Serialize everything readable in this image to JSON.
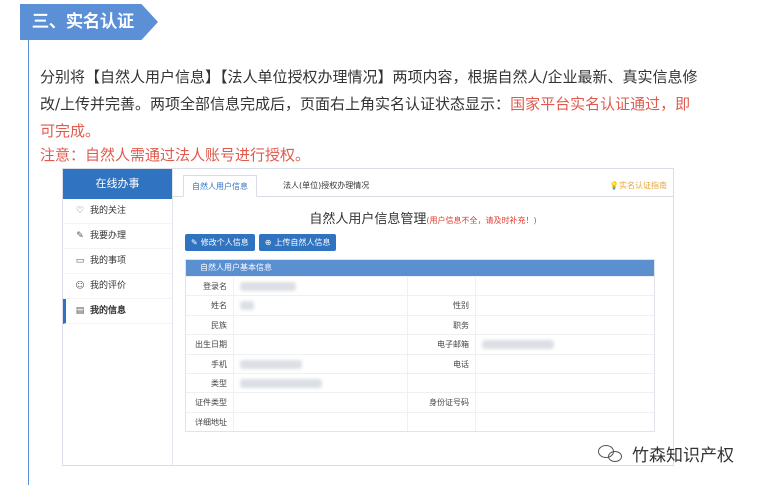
{
  "section": {
    "title": "三、实名认证"
  },
  "intro": {
    "text_plain": "分别将【自然人用户信息】【法人单位授权办理情况】两项内容，根据自然人/企业最新、真实信息修改/上传并完善。两项全部信息完成后，页面右上角实名认证状态显示：",
    "text_red": "国家平台实名认证通过，即可完成。"
  },
  "note": {
    "text": "注意：自然人需通过法人账号进行授权。"
  },
  "screenshot": {
    "sidebar": {
      "title": "在线办事",
      "items": [
        {
          "icon": "heart-icon",
          "glyph": "♡",
          "label": "我的关注"
        },
        {
          "icon": "pencil-icon",
          "glyph": "✎",
          "label": "我要办理"
        },
        {
          "icon": "folder-icon",
          "glyph": "▭",
          "label": "我的事项"
        },
        {
          "icon": "smile-icon",
          "glyph": "☺",
          "label": "我的评价"
        },
        {
          "icon": "card-icon",
          "glyph": "▤",
          "label": "我的信息"
        }
      ]
    },
    "tabs": [
      {
        "label": "自然人用户信息"
      },
      {
        "label": "法人(单位)授权办理情况"
      }
    ],
    "guide": {
      "label": "实名认证指南"
    },
    "page_title": "自然人用户信息管理",
    "warning": "(用户信息不全，请及时补充！)",
    "buttons": [
      {
        "label": "修改个人信息"
      },
      {
        "label": "上传自然人信息"
      }
    ],
    "table": {
      "header": "自然人用户基本信息",
      "rows": [
        {
          "l1": "登录名",
          "l2": ""
        },
        {
          "l1": "姓名",
          "l2": "性别"
        },
        {
          "l1": "民族",
          "l2": "职务"
        },
        {
          "l1": "出生日期",
          "l2": "电子邮箱"
        },
        {
          "l1": "手机",
          "l2": "电话"
        },
        {
          "l1": "类型",
          "l2": ""
        },
        {
          "l1": "证件类型",
          "l2": "身份证号码"
        },
        {
          "l1": "详细地址",
          "l2": ""
        }
      ]
    }
  },
  "watermark": {
    "text": "竹森知识产权",
    "icon": "wechat-icon"
  },
  "colors": {
    "accent": "#5b8fd6",
    "primary": "#2f73c1",
    "red": "#e05a4e",
    "guide": "#e8a43a"
  }
}
